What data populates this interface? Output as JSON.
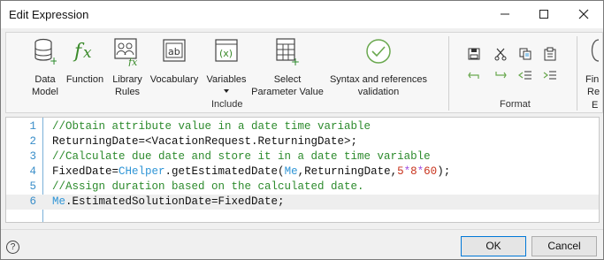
{
  "window": {
    "title": "Edit Expression",
    "controls": [
      "minimize-icon",
      "maximize-icon",
      "close-icon"
    ]
  },
  "ribbon": {
    "include_group": {
      "label": "Include",
      "buttons": [
        {
          "label": "Data Model",
          "icon": "database-icon"
        },
        {
          "label": "Function",
          "icon": "function-icon"
        },
        {
          "label": "Library Rules",
          "icon": "library-rules-icon"
        },
        {
          "label": "Vocabulary",
          "icon": "vocabulary-icon"
        },
        {
          "label": "Variables",
          "icon": "variables-icon"
        },
        {
          "label": "Select Parameter Value",
          "icon": "grid-add-icon"
        },
        {
          "label": "Syntax and references validation",
          "icon": "check-circle-icon"
        }
      ]
    },
    "format_group": {
      "label": "Format",
      "buttons": [
        "save-icon",
        "cut-icon",
        "copy-icon",
        "paste-icon",
        "undo-icon",
        "redo-icon",
        "outdent-icon",
        "indent-icon"
      ]
    },
    "partial_group": {
      "line1": "Fin",
      "line2": "Re",
      "line3": "E"
    }
  },
  "editor": {
    "lines": [
      {
        "n": "1",
        "tokens": [
          {
            "t": "//Obtain attribute value in a date time variable",
            "c": "cm"
          }
        ]
      },
      {
        "n": "2",
        "tokens": [
          {
            "t": "ReturningDate=<VacationRequest.ReturningDate>;",
            "c": ""
          }
        ]
      },
      {
        "n": "3",
        "tokens": [
          {
            "t": "//Calculate due date and store it in a date time variable",
            "c": "cm"
          }
        ]
      },
      {
        "n": "4",
        "tokens": [
          {
            "t": "FixedDate=",
            "c": ""
          },
          {
            "t": "CHelper",
            "c": "kw"
          },
          {
            "t": ".getEstimatedDate(",
            "c": ""
          },
          {
            "t": "Me",
            "c": "kw"
          },
          {
            "t": ",ReturningDate,",
            "c": ""
          },
          {
            "t": "5",
            "c": "nm"
          },
          {
            "t": "*",
            "c": "op"
          },
          {
            "t": "8",
            "c": "nm"
          },
          {
            "t": "*",
            "c": "op"
          },
          {
            "t": "60",
            "c": "nm"
          },
          {
            "t": ");",
            "c": ""
          }
        ]
      },
      {
        "n": "5",
        "tokens": [
          {
            "t": "//Assign duration based on the calculated date.",
            "c": "cm"
          }
        ]
      },
      {
        "n": "6",
        "tokens": [
          {
            "t": "Me",
            "c": "kw"
          },
          {
            "t": ".EstimatedSolutionDate=FixedDate;",
            "c": ""
          }
        ]
      }
    ]
  },
  "footer": {
    "help": "?",
    "ok_label": "OK",
    "cancel_label": "Cancel"
  }
}
